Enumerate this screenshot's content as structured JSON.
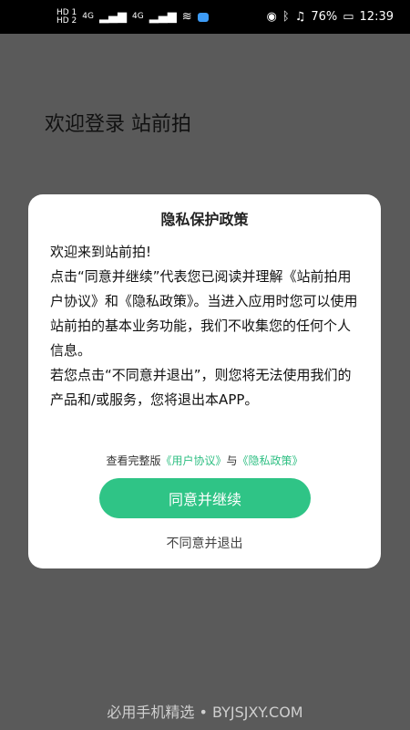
{
  "status_bar": {
    "hd1": "HD 1",
    "hd2": "HD 2",
    "signal1": "4G",
    "signal2": "4G",
    "battery_pct": "76%",
    "time": "12:39",
    "icons": [
      "wifi-icon",
      "cloud-icon",
      "eye-icon",
      "bluetooth-icon",
      "mute-bell-icon",
      "battery-icon"
    ]
  },
  "background": {
    "title": "欢迎登录 站前拍"
  },
  "dialog": {
    "title": "隐私保护政策",
    "paragraphs": [
      "欢迎来到站前拍!",
      "点击“同意并继续”代表您已阅读并理解《站前拍用户协议》和《隐私政策》。当进入应用时您可以使用站前拍的基本业务功能，我们不收集您的任何个人信息。",
      "若您点击“不同意并退出”，则您将无法使用我们的产品和/或服务，您将退出本APP。"
    ],
    "links_prefix": "查看完整版",
    "link_user": "《用户协议》",
    "links_and": "与",
    "link_privacy": "《隐私政策》",
    "agree_label": "同意并继续",
    "decline_label": "不同意并退出",
    "accent_color": "#2fc486"
  },
  "footer": {
    "text": "必用手机精选 • BYJSJXY.COM"
  }
}
